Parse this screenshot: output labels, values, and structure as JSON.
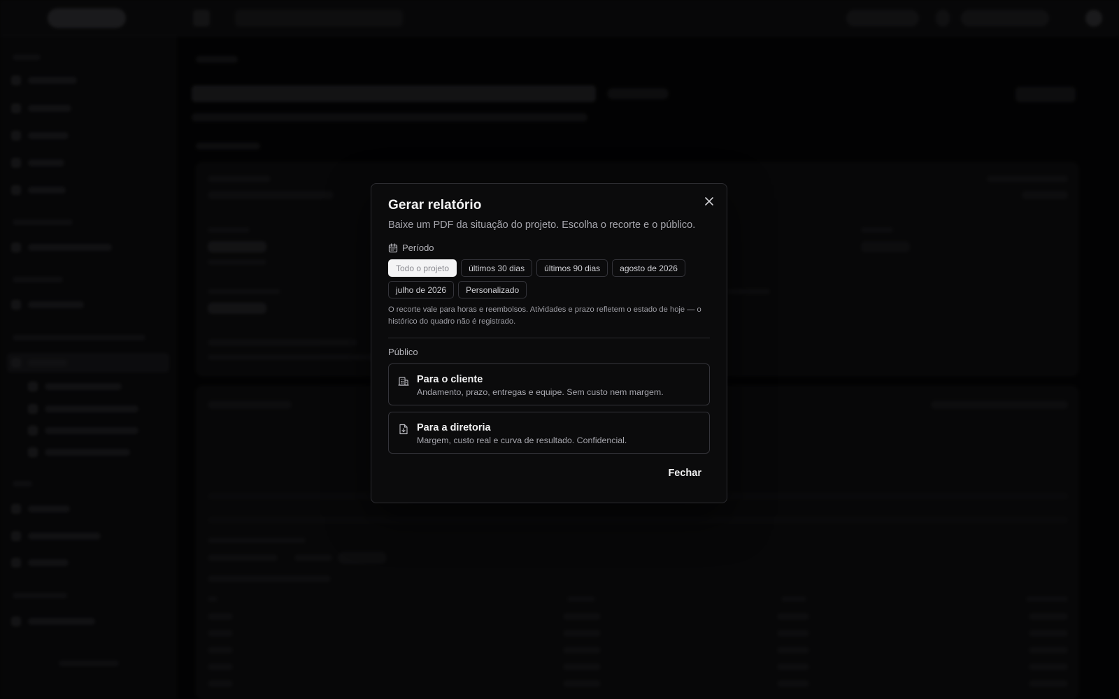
{
  "modal": {
    "title": "Gerar relatório",
    "subtitle": "Baixe um PDF da situação do projeto. Escolha o recorte e o público.",
    "period_label": "Período",
    "period_icon": "calendar-icon",
    "period_options": [
      {
        "label": "Todo o projeto",
        "selected": true
      },
      {
        "label": "últimos 30 dias",
        "selected": false
      },
      {
        "label": "últimos 90 dias",
        "selected": false
      },
      {
        "label": "agosto de 2026",
        "selected": false
      },
      {
        "label": "julho de 2026",
        "selected": false
      },
      {
        "label": "Personalizado",
        "selected": false
      }
    ],
    "note": "O recorte vale para horas e reembolsos. Atividades e prazo refletem o estado de hoje — o histórico do quadro não é registrado.",
    "audience_label": "Público",
    "audience_options": [
      {
        "icon": "building-icon",
        "title": "Para o cliente",
        "description": "Andamento, prazo, entregas e equipe. Sem custo nem margem."
      },
      {
        "icon": "file-download-icon",
        "title": "Para a diretoria",
        "description": "Margem, custo real e curva de resultado. Confidencial."
      }
    ],
    "close_label": "Fechar",
    "close_icon": "close-icon"
  },
  "colors": {
    "background": "#0b0b0c",
    "modal_border": "#2c2c30",
    "text_primary": "#f4f4f5",
    "text_muted": "#a6a6ad",
    "chip_selected_bg": "#f4f4f5"
  }
}
